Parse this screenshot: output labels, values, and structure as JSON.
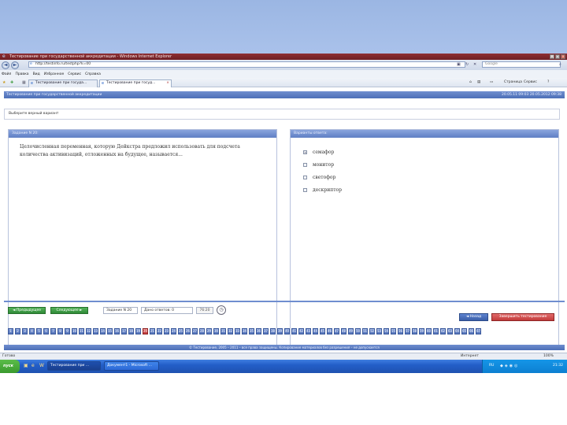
{
  "window": {
    "title": "Тестирование при государственной аккредитации - Windows Internet Explorer",
    "controls": [
      "_",
      "□",
      "x"
    ]
  },
  "address_bar": {
    "url": "http://testinfo.ru/testphp?k=00",
    "search_placeholder": "Google"
  },
  "menu": [
    "Файл",
    "Правка",
    "Вид",
    "Избранное",
    "Сервис",
    "Справка"
  ],
  "tabs": [
    {
      "label": "Тестирование при госуда..."
    },
    {
      "label": "Тестирование при госуд..."
    }
  ],
  "command_bar": {
    "page": "Страница",
    "tools": "Сервис"
  },
  "page": {
    "header_title": "Тестирование при государственной аккредитации",
    "header_datetime": "20.05.11 09:03 20.05.2012 09:38",
    "instruction": "Выберите верный вариант",
    "question_panel_title": "Задание N 20:",
    "question_text": "Целочисленная переменная, которую Дейкстра предложил использовать для подсчета количества активизаций, отложенных на будущее, называется...",
    "answers_panel_title": "Варианты ответа:",
    "options": [
      {
        "label": "семафор",
        "checked": true
      },
      {
        "label": "монитор",
        "checked": false
      },
      {
        "label": "светофор",
        "checked": false
      },
      {
        "label": "дескриптор",
        "checked": false
      }
    ],
    "prev_button": "◄ Предыдущее",
    "next_button": "Следующее ►",
    "task_counter": "Задание N 20",
    "answered_counter": "Дано ответов: 0",
    "timer": "76:20",
    "back_button": "◄ Назад",
    "finish_button": "Завершить тестирование",
    "question_numbers": [
      "1",
      "2",
      "3",
      "4",
      "5",
      "6",
      "7",
      "8",
      "9",
      "10",
      "11",
      "12",
      "13",
      "14",
      "15",
      "16",
      "17",
      "18",
      "19",
      "20",
      "21",
      "22",
      "23",
      "24",
      "25",
      "26",
      "27",
      "28",
      "29",
      "30",
      "31",
      "32",
      "33",
      "34",
      "35",
      "36",
      "37",
      "38",
      "39",
      "40",
      "41",
      "42",
      "43",
      "44",
      "45",
      "46",
      "47",
      "48",
      "49",
      "50",
      "51",
      "52",
      "53",
      "54",
      "55",
      "56",
      "57",
      "58",
      "59",
      "60",
      "61",
      "62",
      "63",
      "64",
      "65",
      "66",
      "67"
    ],
    "current_question_index": 19,
    "footer": "© Тестирование, 2005 – 2011 – все права защищены. Копирование материалов без разрешения – не допускается"
  },
  "status_bar": {
    "left": "Готово",
    "zone": "Интернет",
    "zoom": "100%"
  },
  "taskbar": {
    "start": "пуск",
    "buttons": [
      {
        "label": "Тестирование при ...",
        "active": true
      },
      {
        "label": "Документ1 - Microsoft ...",
        "active": false
      }
    ],
    "lang": "RU",
    "clock": "21:32"
  },
  "colors": {
    "accent_blue": "#5f7fc4",
    "button_green": "#3a9a3a",
    "button_red": "#c23b3b",
    "title_bar": "#7e272c"
  }
}
